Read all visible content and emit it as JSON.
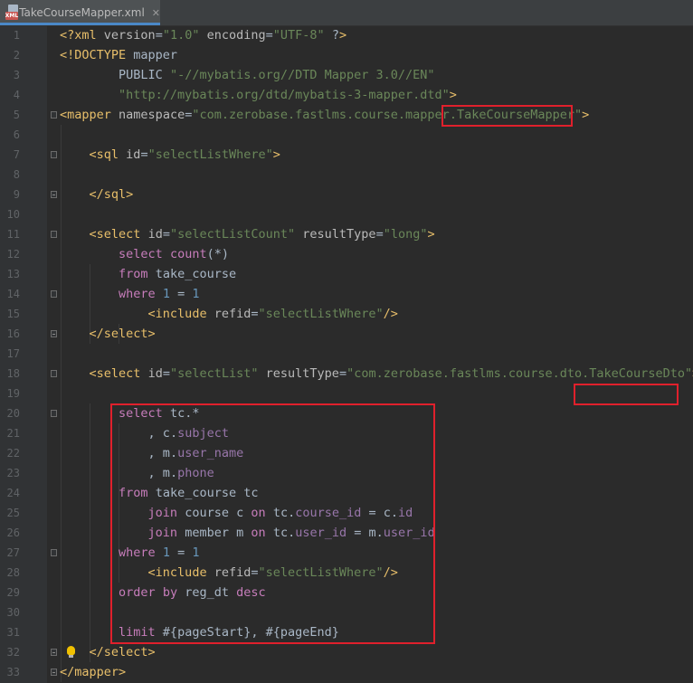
{
  "tab": {
    "title": "TakeCourseMapper.xml",
    "badge": "XML"
  },
  "lines": [
    "<?xml version=\"1.0\" encoding=\"UTF-8\" ?>",
    "<!DOCTYPE mapper",
    "        PUBLIC \"-//mybatis.org//DTD Mapper 3.0//EN\"",
    "        \"http://mybatis.org/dtd/mybatis-3-mapper.dtd\">",
    "<mapper namespace=\"com.zerobase.fastlms.course.mapper.TakeCourseMapper\">",
    "",
    "    <sql id=\"selectListWhere\">",
    "",
    "    </sql>",
    "",
    "    <select id=\"selectListCount\" resultType=\"long\">",
    "        select count(*)",
    "        from take_course",
    "        where 1 = 1",
    "            <include refid=\"selectListWhere\"/>",
    "    </select>",
    "",
    "    <select id=\"selectList\" resultType=\"com.zerobase.fastlms.course.dto.TakeCourseDto\">",
    "",
    "        select tc.*",
    "            , c.subject",
    "            , m.user_name",
    "            , m.phone",
    "        from take_course tc",
    "            join course c on tc.course_id = c.id",
    "            join member m on tc.user_id = m.user_id",
    "        where 1 = 1",
    "            <include refid=\"selectListWhere\"/>",
    "        order by reg_dt desc",
    "",
    "        limit #{pageStart}, #{pageEnd}",
    "    </select>",
    "</mapper>"
  ],
  "line_numbers": [
    "1",
    "2",
    "3",
    "4",
    "5",
    "6",
    "7",
    "8",
    "9",
    "10",
    "11",
    "12",
    "13",
    "14",
    "15",
    "16",
    "17",
    "18",
    "19",
    "20",
    "21",
    "22",
    "23",
    "24",
    "25",
    "26",
    "27",
    "28",
    "29",
    "30",
    "31",
    "32",
    "33"
  ],
  "colors": {
    "background": "#2b2b2b",
    "gutter": "#313335",
    "highlight_box": "#e0202c",
    "tag": "#e8bf6a",
    "string": "#6a8759",
    "keyword": "#cc7832",
    "column": "#9876aa",
    "sql_keyword": "#c77dbb"
  },
  "icons": {
    "tab_icon": "xml-file-icon",
    "gutter_icon": "lightbulb-icon"
  }
}
